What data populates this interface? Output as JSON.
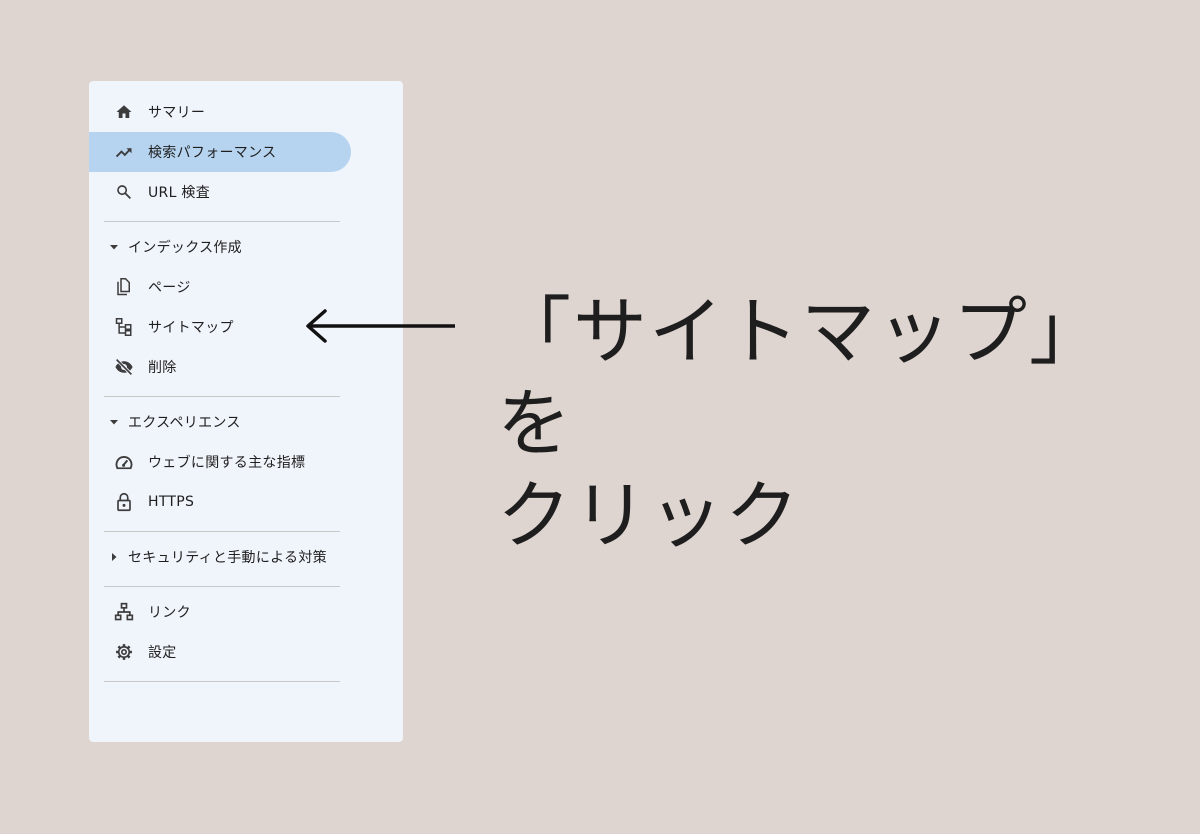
{
  "sidebar": {
    "items_top": [
      {
        "label": "サマリー",
        "icon": "home-icon"
      },
      {
        "label": "検索パフォーマンス",
        "icon": "trending-up-icon",
        "active": true
      },
      {
        "label": "URL 検査",
        "icon": "search-icon"
      }
    ],
    "indexing": {
      "title": "インデックス作成",
      "items": [
        {
          "label": "ページ",
          "icon": "pages-icon"
        },
        {
          "label": "サイトマップ",
          "icon": "sitemap-icon"
        },
        {
          "label": "削除",
          "icon": "visibility-off-icon"
        }
      ]
    },
    "experience": {
      "title": "エクスペリエンス",
      "items": [
        {
          "label": "ウェブに関する主な指標",
          "icon": "speed-icon"
        },
        {
          "label": "HTTPS",
          "icon": "lock-icon"
        }
      ]
    },
    "security": {
      "title": "セキュリティと手動による対策"
    },
    "items_bottom": [
      {
        "label": "リンク",
        "icon": "links-icon"
      },
      {
        "label": "設定",
        "icon": "gear-icon"
      }
    ]
  },
  "annotation": {
    "line1": "「サイトマップ」を",
    "line2": "クリック",
    "arrow_icon": "arrow-left-icon"
  },
  "colors": {
    "background": "#ded4d0",
    "panel": "#f0f4fb",
    "active_item": "#b6d4f0",
    "icon": "#3c3c3c"
  }
}
